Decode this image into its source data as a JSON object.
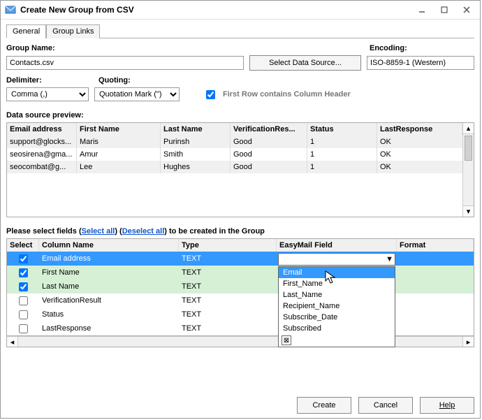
{
  "window": {
    "title": "Create New Group from CSV"
  },
  "tabs": {
    "general": "General",
    "links": "Group Links"
  },
  "labels": {
    "group_name": "Group Name:",
    "encoding": "Encoding:",
    "delimiter": "Delimiter:",
    "quoting": "Quoting:",
    "first_row": "First Row contains Column Header",
    "preview": "Data source preview:",
    "select_fields_pre": "Please select fields (",
    "select_all": "Select all",
    "select_mid": ") (",
    "deselect_all": "Deselect all",
    "select_fields_post": ") to be created in the Group"
  },
  "values": {
    "group_name": "Contacts.csv",
    "encoding": "ISO-8859-1 (Western)",
    "delimiter": "Comma (,)",
    "quoting": "Quotation Mark (\")",
    "first_row_checked": true,
    "select_source_btn": "Select Data Source..."
  },
  "preview": {
    "headers": [
      "Email address",
      "First Name",
      "Last Name",
      "VerificationRes...",
      "Status",
      "LastResponse"
    ],
    "rows": [
      [
        "support@glocks...",
        "Maris",
        "Purinsh",
        "Good",
        "1",
        "OK"
      ],
      [
        "seosirena@gma...",
        "Amur",
        "Smith",
        "Good",
        "1",
        "OK"
      ],
      [
        "seocombat@g...",
        "Lee",
        "Hughes",
        "Good",
        "1",
        "OK"
      ]
    ]
  },
  "mapping": {
    "headers": {
      "select": "Select",
      "column": "Column Name",
      "type": "Type",
      "field": "EasyMail Field",
      "format": "Format"
    },
    "rows": [
      {
        "checked": true,
        "selected": true,
        "column": "Email address",
        "type": "TEXT"
      },
      {
        "checked": true,
        "selected": false,
        "column": "First Name",
        "type": "TEXT"
      },
      {
        "checked": true,
        "selected": false,
        "column": "Last Name",
        "type": "TEXT"
      },
      {
        "checked": false,
        "selected": false,
        "column": "VerificationResult",
        "type": "TEXT"
      },
      {
        "checked": false,
        "selected": false,
        "column": "Status",
        "type": "TEXT"
      },
      {
        "checked": false,
        "selected": false,
        "column": "LastResponse",
        "type": "TEXT"
      }
    ]
  },
  "dropdown": {
    "items": [
      "Email",
      "First_Name",
      "Last_Name",
      "Recipient_Name",
      "Subscribe_Date",
      "Subscribed"
    ],
    "highlighted": 0
  },
  "footer": {
    "create": "Create",
    "cancel": "Cancel",
    "help": "Help"
  }
}
